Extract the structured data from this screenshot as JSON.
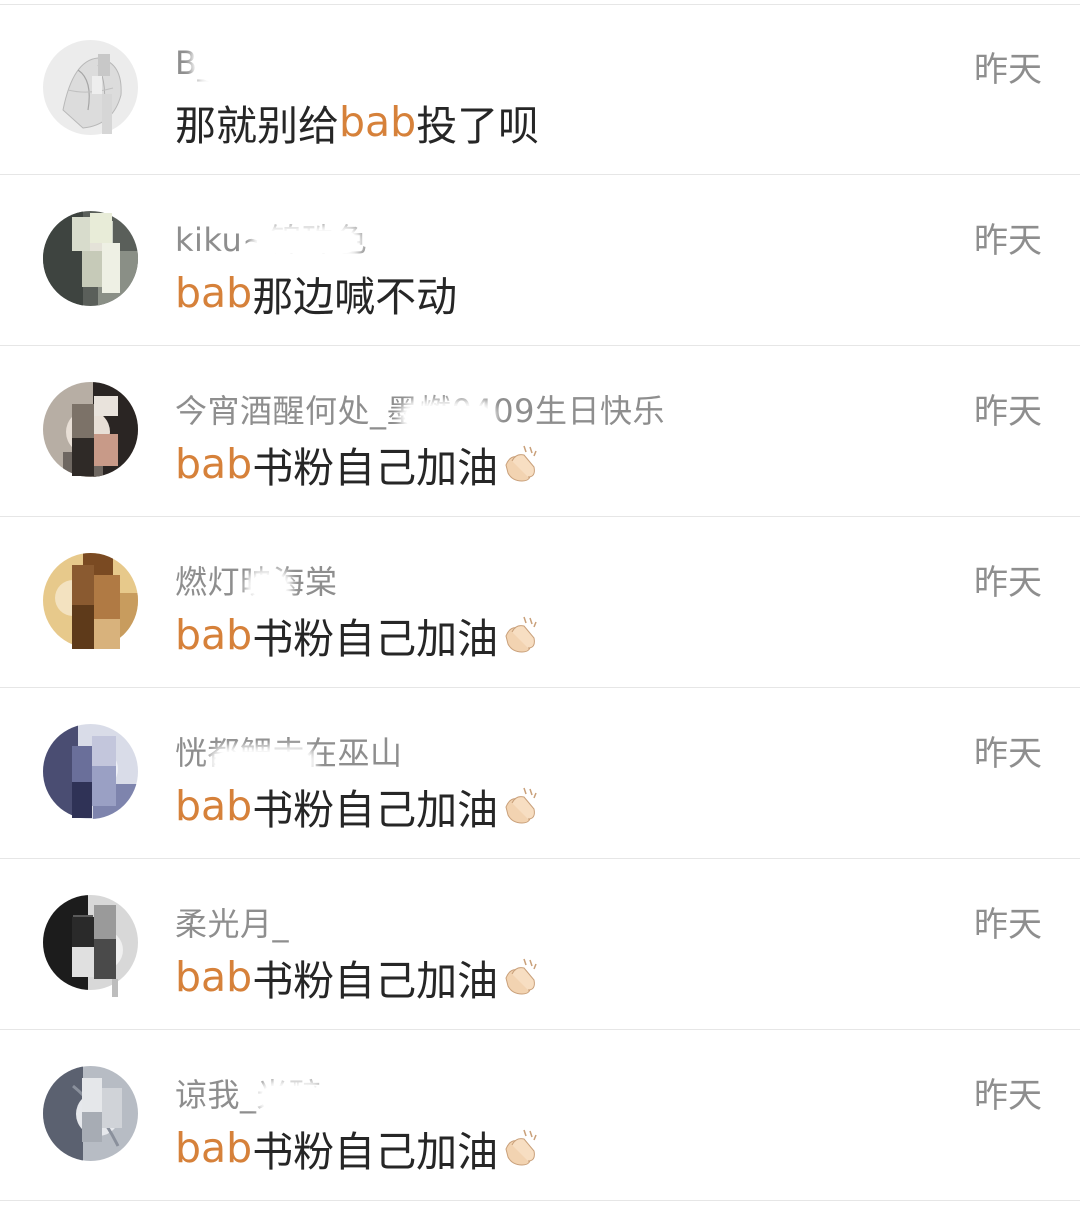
{
  "colors": {
    "mention": "#d6813a",
    "username": "#8e8e8e",
    "text": "#262626",
    "time": "#8e8e8e",
    "divider": "#e6e6e6"
  },
  "comments": [
    {
      "username": "B__ly",
      "mention": "",
      "text": "那就别给bab投了呗",
      "text_before": "那就别给",
      "text_mention": "bab",
      "text_after": "投了呗",
      "emoji": "",
      "time": "昨天",
      "avatar_icon": "avatar-sketch"
    },
    {
      "username": "kiku~锦珠色",
      "text_before": "",
      "text_mention": "bab",
      "text_after": "那边喊不动",
      "emoji": "",
      "time": "昨天",
      "avatar_icon": "avatar-portrait"
    },
    {
      "username": "今宵酒醒何处_墨燃0409生日快乐",
      "text_before": "",
      "text_mention": "bab",
      "text_after": "书粉自己加油",
      "emoji": "clapping-hands-icon",
      "time": "昨天",
      "avatar_icon": "avatar-portrait"
    },
    {
      "username": "燃灯映海棠",
      "text_before": "",
      "text_mention": "bab",
      "text_after": "书粉自己加油",
      "emoji": "clapping-hands-icon",
      "time": "昨天",
      "avatar_icon": "avatar-portrait"
    },
    {
      "username": "恍都鲤走在巫山",
      "text_before": "",
      "text_mention": "bab",
      "text_after": "书粉自己加油",
      "emoji": "clapping-hands-icon",
      "time": "昨天",
      "avatar_icon": "avatar-portrait"
    },
    {
      "username": "柔光月_",
      "text_before": "",
      "text_mention": "bab",
      "text_after": "书粉自己加油",
      "emoji": "clapping-hands-icon",
      "time": "昨天",
      "avatar_icon": "avatar-portrait"
    },
    {
      "username": "谅我_光醉",
      "text_before": "",
      "text_mention": "bab",
      "text_after": "书粉自己加油",
      "emoji": "clapping-hands-icon",
      "time": "昨天",
      "avatar_icon": "avatar-portrait"
    }
  ]
}
